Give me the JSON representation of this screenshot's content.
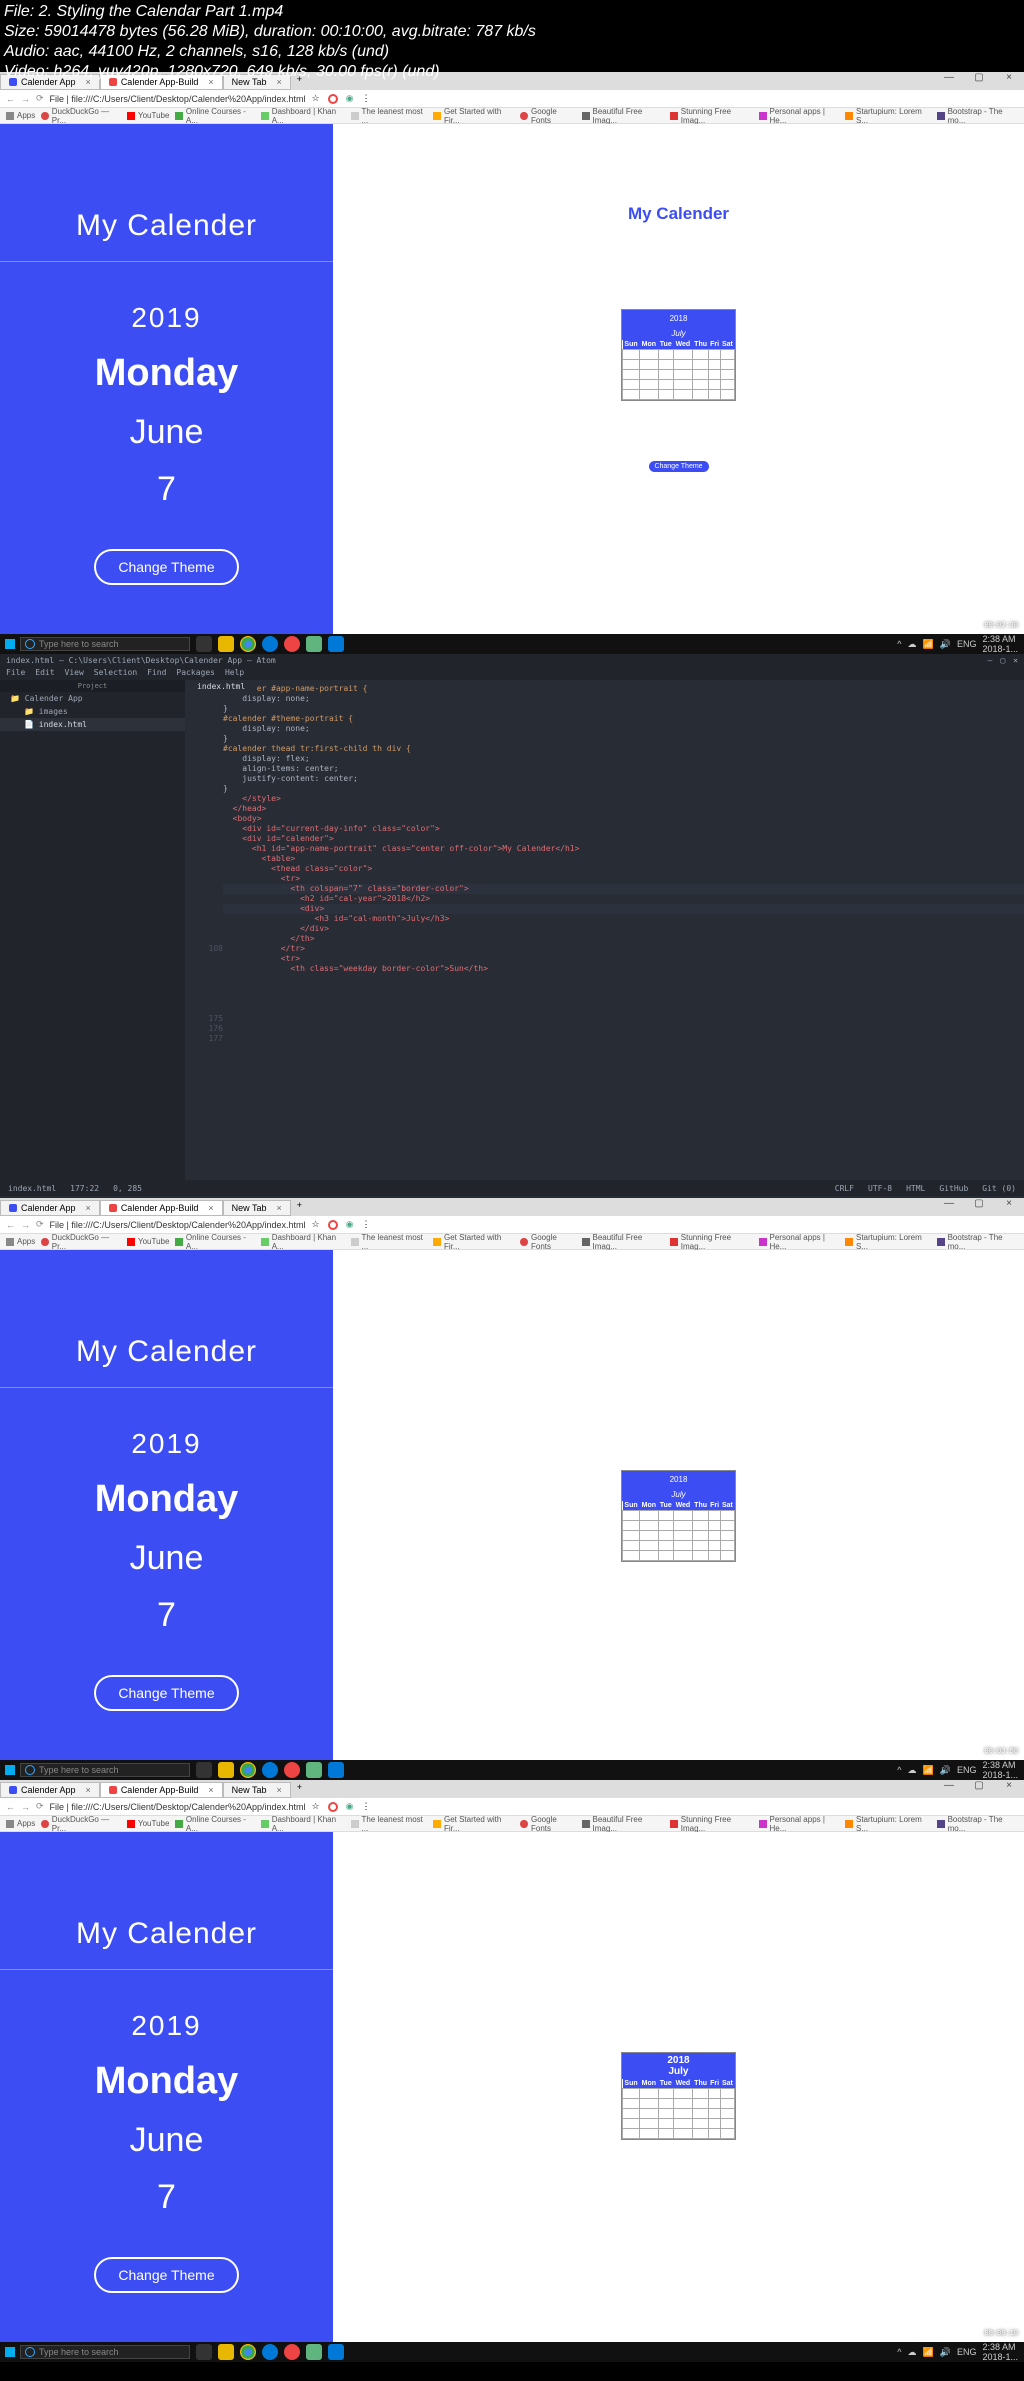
{
  "media_info": {
    "file": "File: 2. Styling the Calendar Part 1.mp4",
    "size": "Size: 59014478 bytes (56.28 MiB), duration: 00:10:00, avg.bitrate: 787 kb/s",
    "audio": "Audio: aac, 44100 Hz, 2 channels, s16, 128 kb/s (und)",
    "video": "Video: h264, yuv420p, 1280x720, 649 kb/s, 30.00 fps(r) (und)"
  },
  "browser": {
    "tabs": [
      {
        "label": "Calender App"
      },
      {
        "label": "Calender App-Build"
      },
      {
        "label": "New Tab"
      }
    ],
    "url": "File | file:///C:/Users/Client/Desktop/Calender%20App/index.html",
    "bookmarks": [
      "Apps",
      "DuckDuckGo — Pr...",
      "YouTube",
      "Online Courses - A...",
      "Dashboard | Khan A...",
      "The leanest most ...",
      "Get Started with Fir...",
      "Google Fonts",
      "Beautiful Free Imag...",
      "Stunning Free Imag...",
      "Personal apps | He...",
      "Startupium: Lorem S...",
      "Bootstrap - The mo..."
    ]
  },
  "calendar": {
    "title": "My Calender",
    "year": "2019",
    "weekday": "Monday",
    "month": "June",
    "date": "7",
    "button": "Change Theme",
    "mini": {
      "year": "2018",
      "month": "July",
      "dow": [
        "Sun",
        "Mon",
        "Tue",
        "Wed",
        "Thu",
        "Fri",
        "Sat"
      ],
      "btn": "Change Theme"
    }
  },
  "taskbar": {
    "search": "Type here to search",
    "lang": "ENG",
    "time": "2:38 AM",
    "date": "2018-1..."
  },
  "timestamps": [
    "00:02:30",
    "00:03:50",
    "00:08:10"
  ],
  "atom": {
    "title": "index.html — C:\\Users\\Client\\Desktop\\Calender App — Atom",
    "menu": [
      "File",
      "Edit",
      "View",
      "Selection",
      "Find",
      "Packages",
      "Help"
    ],
    "tree_header": "Project",
    "tree": [
      {
        "label": "Calender App",
        "sel": false,
        "sub": false
      },
      {
        "label": "images",
        "sel": false,
        "sub": true
      },
      {
        "label": "index.html",
        "sel": true,
        "sub": true
      }
    ],
    "tab": "index.html",
    "status": {
      "left": [
        "index.html",
        "177:22",
        "0, 285"
      ],
      "right": [
        "CRLF",
        "UTF-8",
        "HTML",
        "GitHub",
        "Git (0)"
      ]
    },
    "code": [
      {
        "n": "",
        "t": "#calender #app-name-portrait {",
        "cls": "c-org"
      },
      {
        "n": "",
        "t": "    display: none;",
        "cls": ""
      },
      {
        "n": "",
        "t": "}",
        "cls": ""
      },
      {
        "n": "",
        "t": "",
        "cls": ""
      },
      {
        "n": "",
        "t": "#calender #theme-portrait {",
        "cls": "c-org"
      },
      {
        "n": "",
        "t": "    display: none;",
        "cls": ""
      },
      {
        "n": "",
        "t": "}",
        "cls": ""
      },
      {
        "n": "",
        "t": "",
        "cls": ""
      },
      {
        "n": "",
        "t": "#calender thead tr:first-child th div {",
        "cls": "c-org"
      },
      {
        "n": "",
        "t": "    display: flex;",
        "cls": ""
      },
      {
        "n": "",
        "t": "    align-items: center;",
        "cls": ""
      },
      {
        "n": "",
        "t": "    justify-content: center;",
        "cls": ""
      },
      {
        "n": "",
        "t": "}",
        "cls": ""
      },
      {
        "n": "",
        "t": "",
        "cls": ""
      },
      {
        "n": "",
        "t": "",
        "cls": ""
      },
      {
        "n": "",
        "t": "",
        "cls": ""
      },
      {
        "n": "",
        "t": "",
        "cls": ""
      },
      {
        "n": "",
        "t": "",
        "cls": ""
      },
      {
        "n": "",
        "t": "",
        "cls": ""
      },
      {
        "n": "",
        "t": "",
        "cls": ""
      },
      {
        "n": "",
        "t": "",
        "cls": ""
      },
      {
        "n": "",
        "t": "",
        "cls": ""
      },
      {
        "n": "",
        "t": "    </style>",
        "cls": "c-red"
      },
      {
        "n": "",
        "t": "  </head>",
        "cls": "c-red"
      },
      {
        "n": "",
        "t": "  <body>",
        "cls": "c-red"
      },
      {
        "n": "",
        "t": "",
        "cls": ""
      },
      {
        "n": "108",
        "t": "    <div id=\"current-day-info\" class=\"color\">",
        "cls": "c-red"
      },
      {
        "n": "",
        "t": "",
        "cls": ""
      },
      {
        "n": "",
        "t": "    <div id=\"calender\">",
        "cls": "c-red"
      },
      {
        "n": "",
        "t": "",
        "cls": ""
      },
      {
        "n": "",
        "t": "      <h1 id=\"app-name-portrait\" class=\"center off-color\">My Calender</h1>",
        "cls": "c-red"
      },
      {
        "n": "",
        "t": "        <table>",
        "cls": "c-red"
      },
      {
        "n": "",
        "t": "          <thead class=\"color\">",
        "cls": "c-red"
      },
      {
        "n": "175",
        "t": "            <tr>",
        "cls": "c-red"
      },
      {
        "n": "176",
        "t": "              <th colspan=\"7\" class=\"border-color\">",
        "cls": "c-red hl"
      },
      {
        "n": "177",
        "t": "                <h2 id=\"cal-year\">2018</h2>",
        "cls": "c-red"
      },
      {
        "n": "",
        "t": "                <div>",
        "cls": "c-red hl"
      },
      {
        "n": "",
        "t": "                   <h3 id=\"cal-month\">July</h3>",
        "cls": "c-red"
      },
      {
        "n": "",
        "t": "                </div>",
        "cls": "c-red"
      },
      {
        "n": "",
        "t": "              </th>",
        "cls": "c-red"
      },
      {
        "n": "",
        "t": "            </tr>",
        "cls": "c-red"
      },
      {
        "n": "",
        "t": "            <tr>",
        "cls": "c-red"
      },
      {
        "n": "",
        "t": "              <th class=\"weekday border-color\">Sun</th>",
        "cls": "c-red"
      }
    ]
  }
}
